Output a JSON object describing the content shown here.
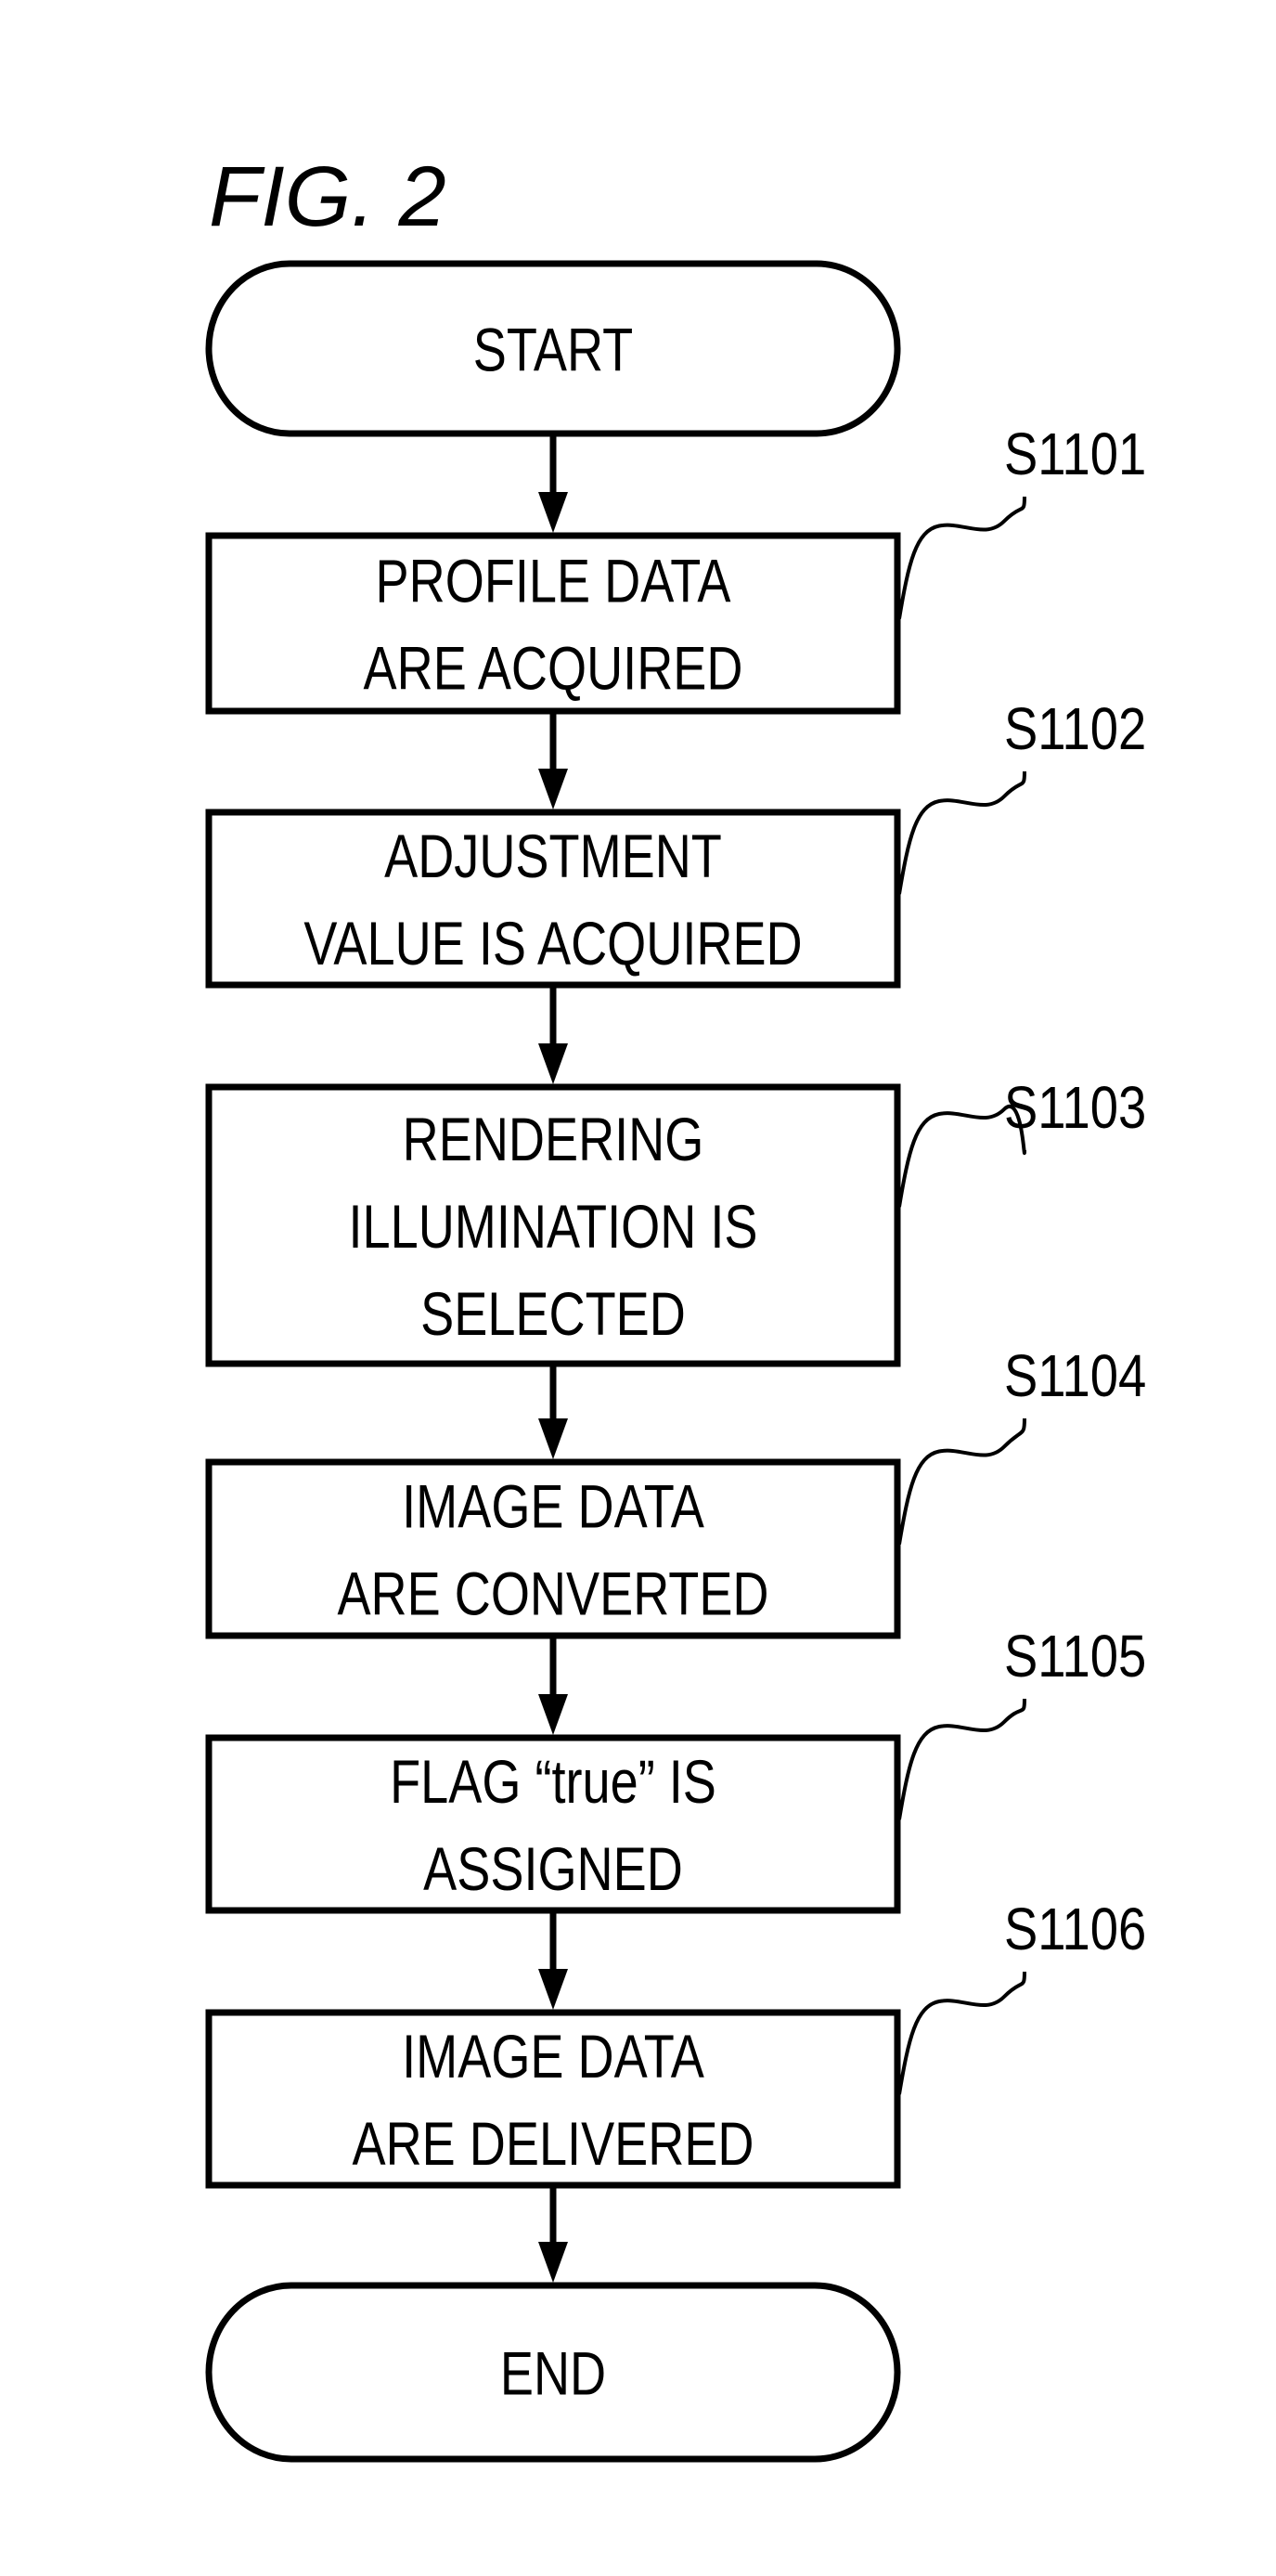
{
  "figure": {
    "title": "FIG. 2"
  },
  "nodes": [
    {
      "id": "start",
      "type": "terminal",
      "lines": [
        "START"
      ]
    },
    {
      "id": "S1101",
      "type": "process",
      "step": "S1101",
      "lines": [
        "PROFILE DATA",
        "ARE ACQUIRED"
      ]
    },
    {
      "id": "S1102",
      "type": "process",
      "step": "S1102",
      "lines": [
        "ADJUSTMENT",
        "VALUE IS ACQUIRED"
      ]
    },
    {
      "id": "S1103",
      "type": "process",
      "step": "S1103",
      "lines": [
        "RENDERING",
        "ILLUMINATION IS",
        "SELECTED"
      ]
    },
    {
      "id": "S1104",
      "type": "process",
      "step": "S1104",
      "lines": [
        "IMAGE DATA",
        "ARE CONVERTED"
      ]
    },
    {
      "id": "S1105",
      "type": "process",
      "step": "S1105",
      "lines": [
        "FLAG “true” IS",
        "ASSIGNED"
      ]
    },
    {
      "id": "S1106",
      "type": "process",
      "step": "S1106",
      "lines": [
        "IMAGE DATA",
        "ARE DELIVERED"
      ]
    },
    {
      "id": "end",
      "type": "terminal",
      "lines": [
        "END"
      ]
    }
  ],
  "edges": [
    [
      "start",
      "S1101"
    ],
    [
      "S1101",
      "S1102"
    ],
    [
      "S1102",
      "S1103"
    ],
    [
      "S1103",
      "S1104"
    ],
    [
      "S1104",
      "S1105"
    ],
    [
      "S1105",
      "S1106"
    ],
    [
      "S1106",
      "end"
    ]
  ]
}
